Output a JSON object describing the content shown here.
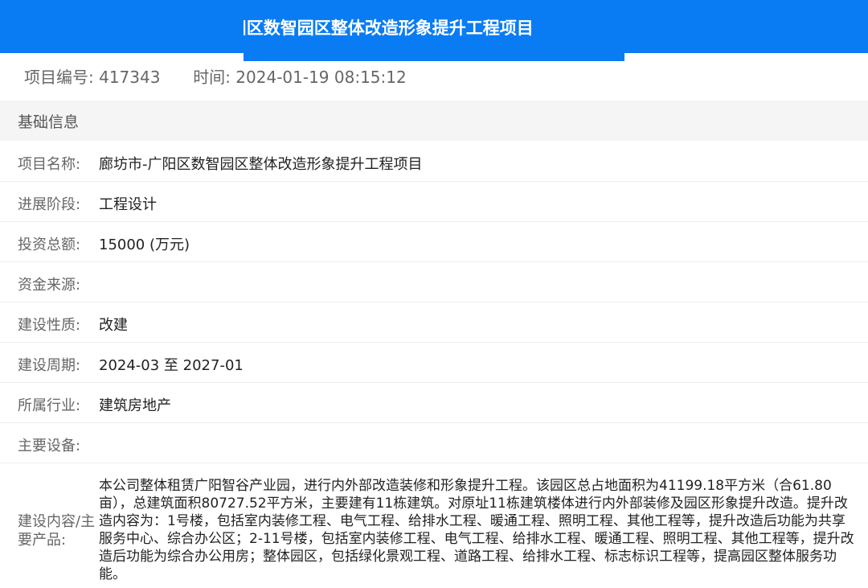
{
  "header": {
    "title": "廊坊市-广阳区数智园区整体改造形象提升工程项目"
  },
  "meta": {
    "project_no_label": "项目编号:",
    "project_no": "417343",
    "time_label": "时间:",
    "time": "2024-01-19 08:15:12"
  },
  "section": {
    "title": "基础信息"
  },
  "rows": [
    {
      "label": "项目名称:",
      "value": "廊坊市-广阳区数智园区整体改造形象提升工程项目"
    },
    {
      "label": "进展阶段:",
      "value": "工程设计"
    },
    {
      "label": "投资总额:",
      "value": "15000 (万元)"
    },
    {
      "label": "资金来源:",
      "value": ""
    },
    {
      "label": "建设性质:",
      "value": "改建"
    },
    {
      "label": "建设周期:",
      "value": "2024-03 至 2027-01"
    },
    {
      "label": "所属行业:",
      "value": "建筑房地产"
    },
    {
      "label": "主要设备:",
      "value": ""
    }
  ],
  "description": {
    "label": "建设内容/主要产品:",
    "value": "本公司整体租赁广阳智谷产业园，进行内外部改造装修和形象提升工程。该园区总占地面积为41199.18平方米（合61.80亩），总建筑面积80727.52平方米，主要建有11栋建筑。对原址11栋建筑楼体进行内外部装修及园区形象提升改造。提升改造内容为：1号楼，包括室内装修工程、电气工程、给排水工程、暖通工程、照明工程、其他工程等，提升改造后功能为共享服务中心、综合办公区；2-11号楼，包括室内装修工程、电气工程、给排水工程、暖通工程、照明工程、其他工程等，提升改造后功能为综合办公用房；整体园区，包括绿化景观工程、道路工程、给排水工程、标志标识工程等，提高园区整体服务功能。"
  }
}
